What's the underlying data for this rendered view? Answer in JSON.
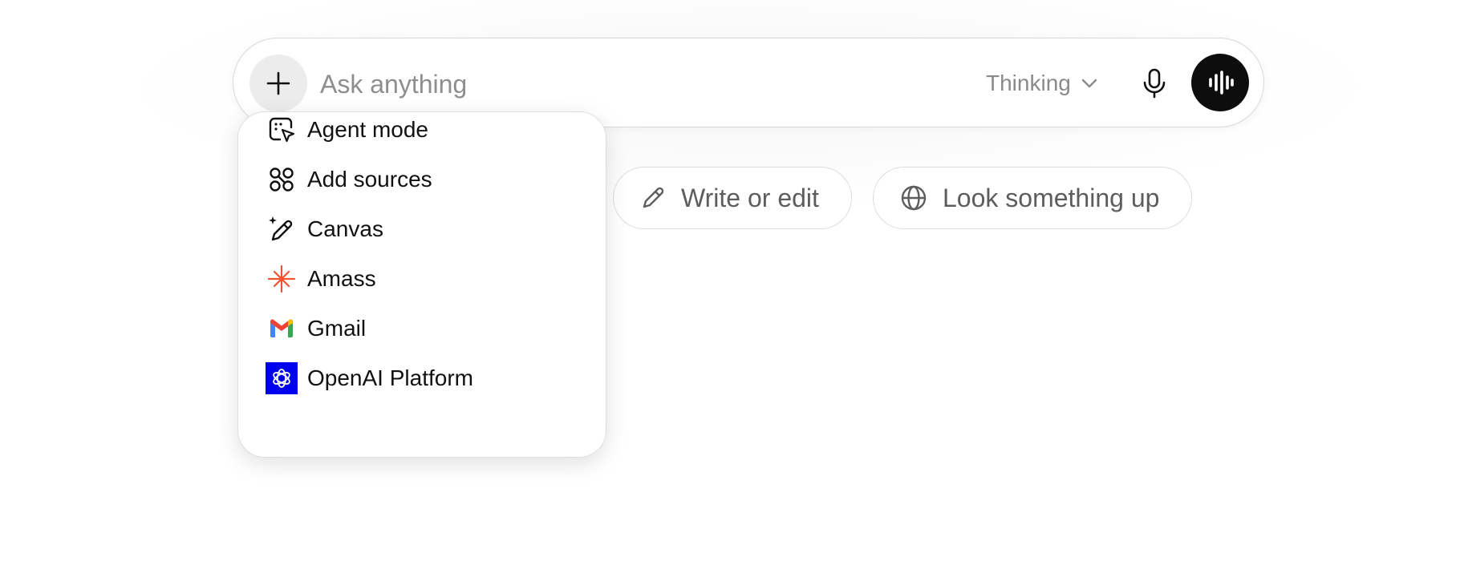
{
  "composer": {
    "placeholder": "Ask anything",
    "model_label": "Thinking"
  },
  "chips": [
    {
      "label": "Write or edit",
      "icon": "pencil-icon"
    },
    {
      "label": "Look something up",
      "icon": "globe-icon"
    }
  ],
  "menu": {
    "items": [
      {
        "label": "Agent mode",
        "icon": "agent-cursor-icon"
      },
      {
        "label": "Add sources",
        "icon": "sources-icon"
      },
      {
        "label": "Canvas",
        "icon": "canvas-pen-icon"
      },
      {
        "label": "Amass",
        "icon": "amass-asterisk-icon"
      },
      {
        "label": "Gmail",
        "icon": "gmail-icon"
      },
      {
        "label": "OpenAI Platform",
        "icon": "openai-icon"
      }
    ]
  },
  "colors": {
    "accent": "#0d0d0d",
    "amass": "#f0522d",
    "openai_tile": "#0000f0",
    "gmail_red": "#ea4335",
    "gmail_blue": "#4285f4",
    "gmail_yellow": "#fbbc04",
    "gmail_green": "#34a853"
  }
}
